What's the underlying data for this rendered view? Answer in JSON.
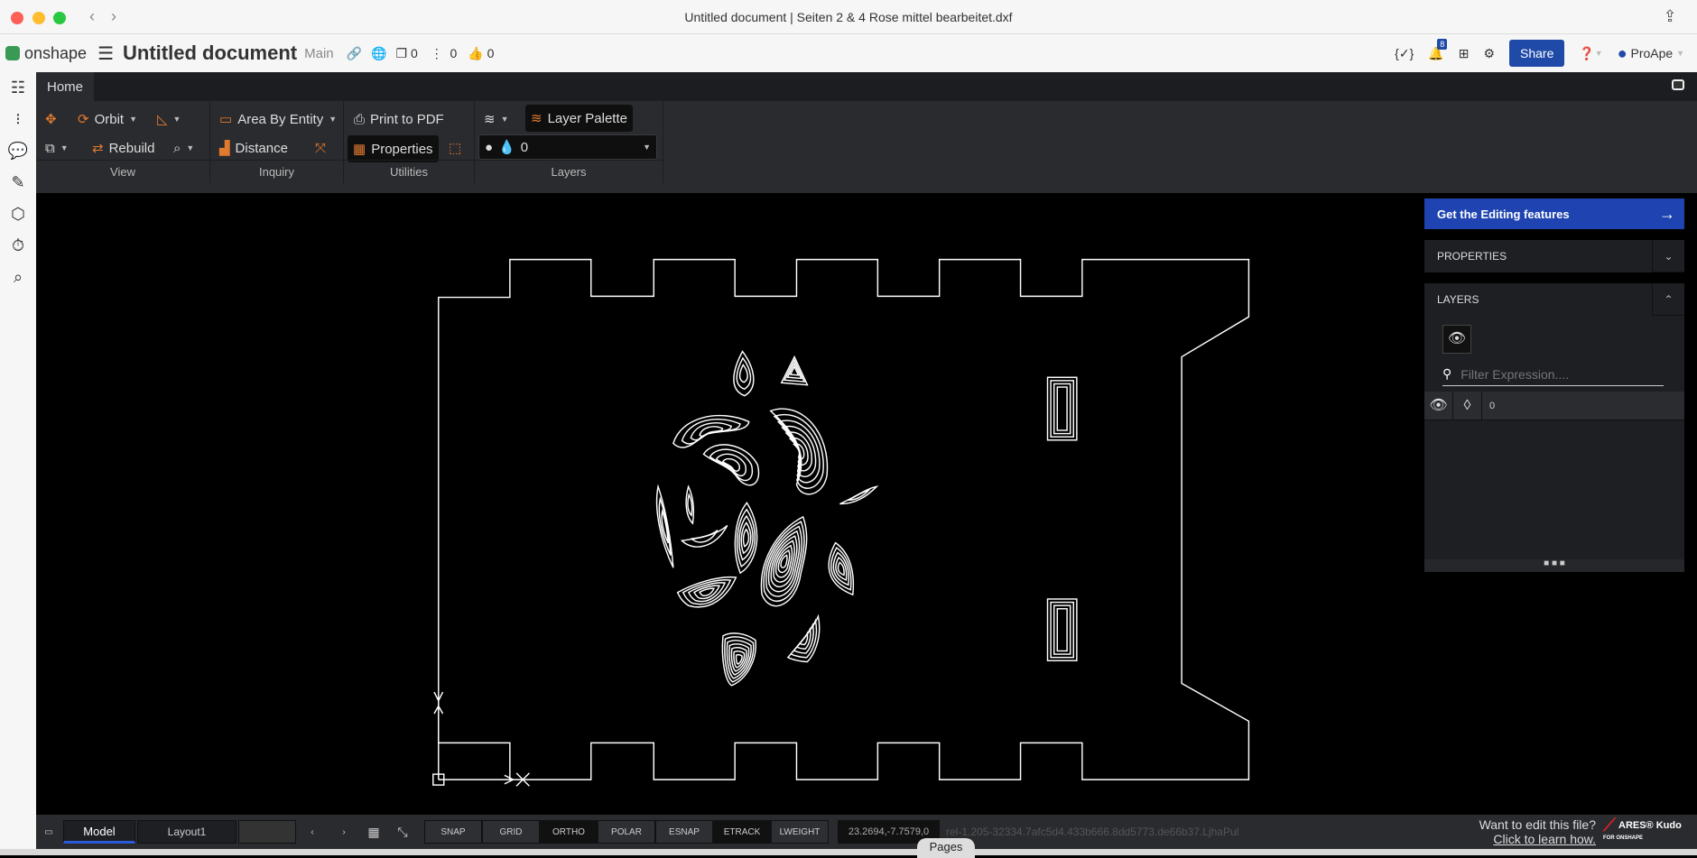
{
  "window": {
    "title": "Untitled document | Seiten 2 & 4 Rose mittel bearbeitet.dxf"
  },
  "header": {
    "brand": "onshape",
    "doc_title": "Untitled document",
    "branch": "Main",
    "versions_count": "0",
    "branches_count": "0",
    "likes_count": "0",
    "notification_count": "8",
    "share_label": "Share",
    "user": "ProApe"
  },
  "ribbon": {
    "tab": "Home",
    "view": {
      "orbit": "Orbit",
      "rebuild": "Rebuild",
      "label": "View"
    },
    "inquiry": {
      "area": "Area By Entity",
      "distance": "Distance",
      "label": "Inquiry"
    },
    "utilities": {
      "print": "Print to PDF",
      "properties": "Properties",
      "label": "Utilities"
    },
    "layers": {
      "palette": "Layer Palette",
      "current_layer": "0",
      "label": "Layers"
    }
  },
  "panel": {
    "cta": "Get the Editing features",
    "properties": "PROPERTIES",
    "layers": "LAYERS",
    "filter_placeholder": "Filter Expression....",
    "layer_rows": [
      {
        "name": "0"
      }
    ]
  },
  "status": {
    "model_tab": "Model",
    "layout_tab": "Layout1",
    "toggles": [
      "SNAP",
      "GRID",
      "ORTHO",
      "POLAR",
      "ESNAP",
      "ETRACK",
      "LWEIGHT"
    ],
    "coords": "23.2694,-7.7579,0",
    "rel": "rel-1.205-32334.7afc5d4.433b666.8dd5773.de66b37.LjhaPul",
    "edit_prompt": "Want to edit this file?",
    "learn_link": "Click to learn how.",
    "ares_logo": "ARES® Kudo FOR ONSHAPE"
  },
  "pages_label": "Pages"
}
